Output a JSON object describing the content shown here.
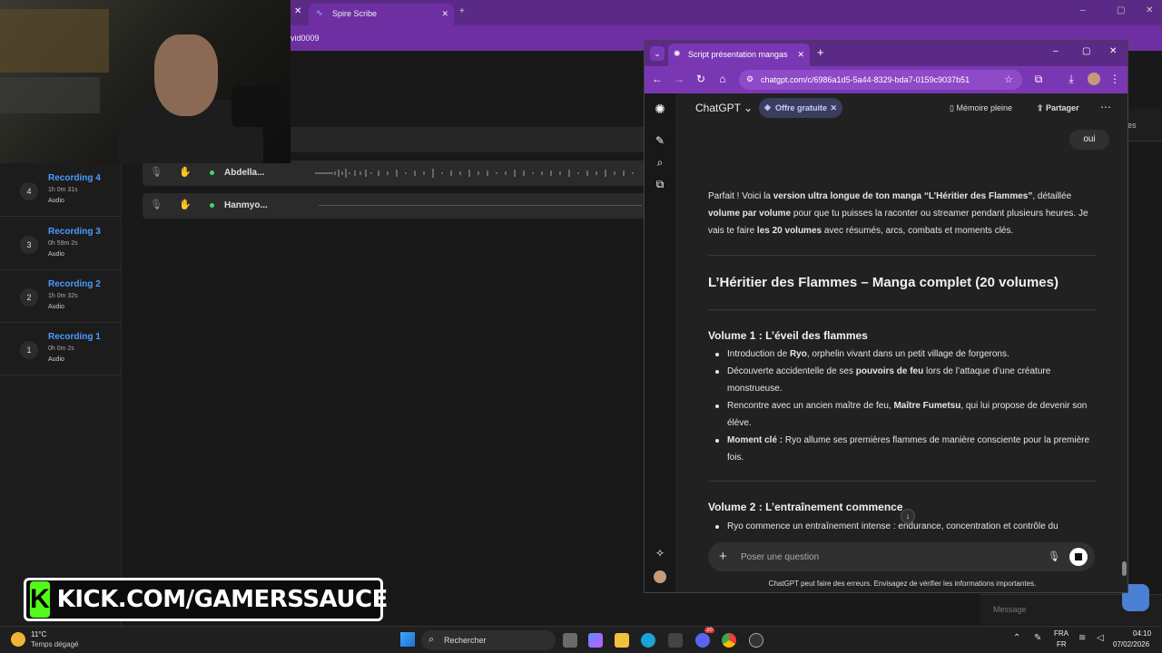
{
  "background_browser": {
    "tab_title": "Spire Scribe",
    "url_fragment": "vid0009",
    "recordings": [
      {
        "num": "4",
        "title": "Recording 4",
        "duration": "1h 0m 31s",
        "type": "Audio"
      },
      {
        "num": "3",
        "title": "Recording 3",
        "duration": "0h 59m 2s",
        "type": "Audio"
      },
      {
        "num": "2",
        "title": "Recording 2",
        "duration": "1h 0m 32s",
        "type": "Audio"
      },
      {
        "num": "1",
        "title": "Recording 1",
        "duration": "0h 0m 2s",
        "type": "Audio"
      }
    ],
    "speakers": [
      "Abdella...",
      "Hanmyo..."
    ],
    "right_fragment": "es",
    "message_placeholder": "Message"
  },
  "kick_banner": {
    "logo": "K",
    "text": "KICK.COM/GAMERSSAUCE"
  },
  "chatgpt_window": {
    "tab_title": "Script présentation mangas",
    "url": "chatgpt.com/c/6986a1d5-5a44-8329-bda7-0159c9037b51",
    "header": {
      "model": "ChatGPT",
      "offer": "Offre gratuite",
      "memory": "Mémoire pleine",
      "share": "Partager"
    },
    "user_message": "oui",
    "intro": {
      "p1": "Parfait ! Voici la ",
      "b1": "version ultra longue de ton manga “L’Héritier des Flammes”",
      "p2": ", détaillée ",
      "b2": "volume par volume",
      "p3": " pour que tu puisses la raconter ou streamer pendant plusieurs heures. Je vais te faire ",
      "b3": "les 20 volumes",
      "p4": " avec résumés, arcs, combats et moments clés."
    },
    "title": "L’Héritier des Flammes – Manga complet (20 volumes)",
    "volume1": {
      "heading": "Volume 1 : L’éveil des flammes",
      "b1a": "Introduction de ",
      "b1b": "Ryo",
      "b1c": ", orphelin vivant dans un petit village de forgerons.",
      "b2a": "Découverte accidentelle de ses ",
      "b2b": "pouvoirs de feu",
      "b2c": " lors de l’attaque d’une créature monstrueuse.",
      "b3a": "Rencontre avec un ancien maître de feu, ",
      "b3b": "Maître Fumetsu",
      "b3c": ", qui lui propose de devenir son élève.",
      "b4b": "Moment clé :",
      "b4c": " Ryo allume ses premières flammes de manière consciente pour la première fois."
    },
    "volume2": {
      "heading": "Volume 2 : L’entraînement commence",
      "b1": "Ryo commence un entraînement intense : endurance, concentration et contrôle du"
    },
    "composer_placeholder": "Poser une question",
    "footer_note": "ChatGPT peut faire des erreurs. Envisagez de vérifier les informations importantes."
  },
  "taskbar": {
    "weather_temp": "11°C",
    "weather_desc": "Temps dégagé",
    "search": "Rechercher",
    "lang_top": "FRA",
    "lang_bottom": "FR",
    "time": "04:10",
    "date": "07/02/2026",
    "badge": "20"
  }
}
